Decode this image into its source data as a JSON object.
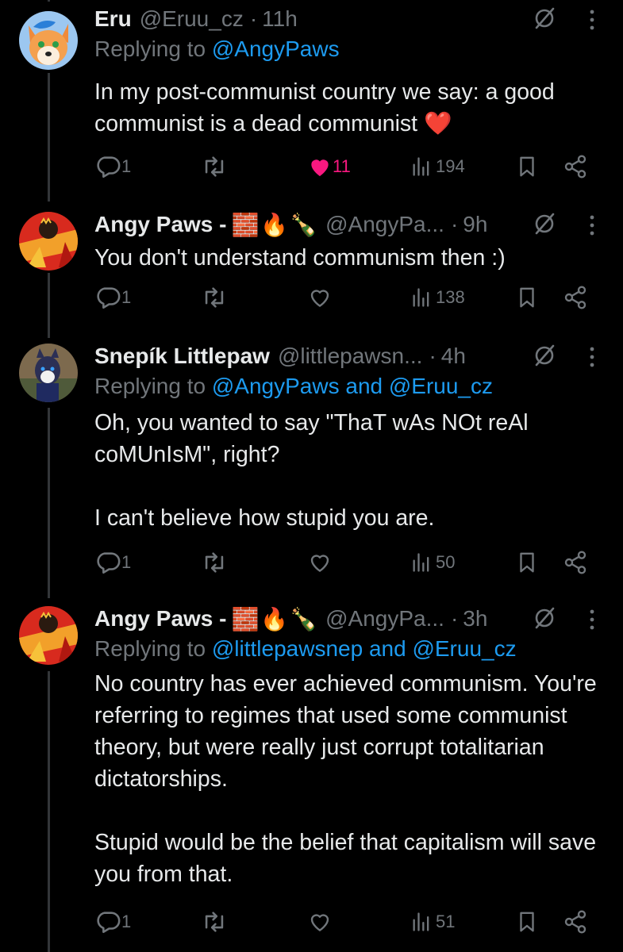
{
  "tweets": [
    {
      "name": "Eru",
      "handle": "@Eruu_cz",
      "time": "11h",
      "replying_prefix": "Replying to ",
      "replying_to": "@AngyPaws",
      "text": "In my post-communist country we say: a good communist is a dead communist",
      "emoji_suffix": "❤️",
      "replies": "1",
      "retweets": "",
      "likes": "11",
      "liked": true,
      "views": "194"
    },
    {
      "name": "Angy Paws -",
      "name_emojis": [
        "🧱",
        "🔥",
        "🍾"
      ],
      "handle": "@AngyPa...",
      "time": "9h",
      "text": "You don't understand communism then :)",
      "replies": "1",
      "likes": "",
      "views": "138"
    },
    {
      "name": "Snepík Littlepaw",
      "handle": "@littlepawsn...",
      "time": "4h",
      "replying_prefix": "Replying to ",
      "replying_to": "@AngyPaws and @Eruu_cz",
      "text": "Oh, you wanted to say \"ThaT wAs NOt reAl coMUnIsM\", right?\n\nI can't believe how stupid you are.",
      "replies": "1",
      "likes": "",
      "views": "50"
    },
    {
      "name": "Angy Paws -",
      "name_emojis": [
        "🧱",
        "🔥",
        "🍾"
      ],
      "handle": "@AngyPa...",
      "time": "3h",
      "replying_prefix": "Replying to ",
      "replying_to": "@littlepawsnep and @Eruu_cz",
      "text": "No country has ever achieved communism. You're referring to regimes that used some communist theory, but were really just corrupt totalitarian dictatorships.\n\nStupid would be the belief that capitalism will save you from that.",
      "replies": "1",
      "likes": "",
      "views": "51"
    }
  ],
  "icons": {
    "reply": "reply-icon",
    "retweet": "retweet-icon",
    "like": "heart-icon",
    "views": "views-icon",
    "bookmark": "bookmark-icon",
    "share": "share-icon",
    "grok": "grok-icon",
    "more": "more-icon"
  },
  "colors": {
    "background": "#000000",
    "text": "#e7e9ea",
    "muted": "#71767b",
    "link": "#1d9bf0",
    "like": "#f91880",
    "thread_line": "#333639"
  }
}
